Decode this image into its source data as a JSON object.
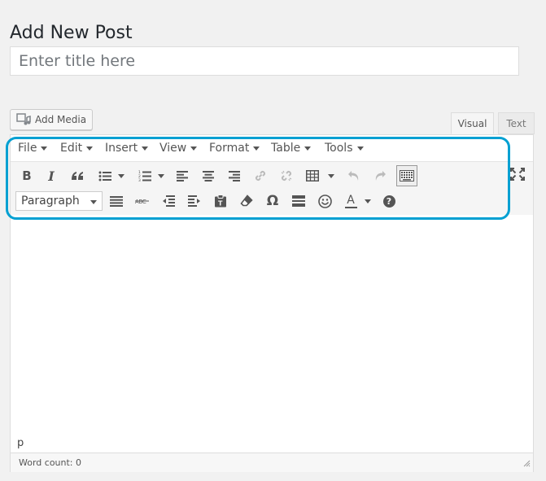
{
  "page": {
    "title": "Add New Post"
  },
  "title_field": {
    "placeholder": "Enter title here",
    "value": ""
  },
  "media": {
    "label": "Add Media"
  },
  "tabs": {
    "visual": "Visual",
    "text": "Text"
  },
  "menubar": [
    {
      "label": "File"
    },
    {
      "label": "Edit"
    },
    {
      "label": "Insert"
    },
    {
      "label": "View"
    },
    {
      "label": "Format"
    },
    {
      "label": "Table"
    },
    {
      "label": "Tools"
    }
  ],
  "toolbar_row1": [
    "bold-icon",
    "italic-icon",
    "blockquote-icon",
    "bullet-list-icon",
    "numbered-list-icon",
    "align-left-icon",
    "align-center-icon",
    "align-right-icon",
    "link-icon",
    "unlink-icon",
    "table-icon",
    "undo-icon",
    "redo-icon",
    "keyboard-icon"
  ],
  "toolbar_row2": [
    "format-select",
    "align-justify-icon",
    "strikethrough-icon",
    "outdent-icon",
    "indent-icon",
    "paste-text-icon",
    "eraser-icon",
    "omega-icon",
    "horizontal-line-icon",
    "smiley-icon",
    "text-color-icon",
    "help-icon"
  ],
  "format_select": {
    "value": "Paragraph"
  },
  "text_color_letter": "A",
  "help_glyph": "?",
  "omega_glyph": "Ω",
  "status": {
    "path": "p",
    "word_count": "Word count: 0"
  },
  "colors": {
    "highlight": "#00a0d2",
    "icon": "#555555",
    "disabled_icon": "#aaaaaa"
  }
}
